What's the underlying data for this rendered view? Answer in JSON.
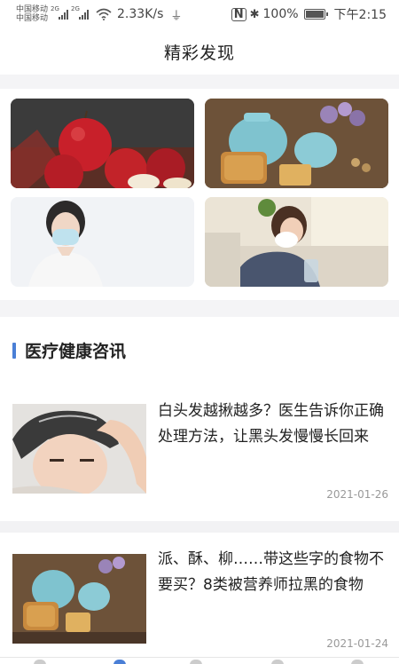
{
  "status_bar": {
    "carrier1": "中国移动",
    "carrier2": "中国移动",
    "sig1_tag": "2G",
    "sig2_tag": "2G",
    "speed": "2.33K/s",
    "battery": "100%",
    "time": "下午2:15"
  },
  "header": {
    "title": "精彩发现"
  },
  "banners": [
    {
      "subject": "apples"
    },
    {
      "subject": "tea and mooncakes"
    },
    {
      "subject": "person wearing mask"
    },
    {
      "subject": "person with cold"
    }
  ],
  "section": {
    "title": "医疗健康咨讯"
  },
  "articles": [
    {
      "title": "白头发越揪越多？医生告诉你正确处理方法，让黑头发慢慢长回来",
      "date": "2021-01-26"
    },
    {
      "title": "派、酥、柳……带这些字的食物不要买？8类被营养师拉黑的食物",
      "date": "2021-01-24"
    }
  ],
  "colors": {
    "accent": "#4a7fd6",
    "date_text": "#999999",
    "background": "#f4f4f6"
  }
}
